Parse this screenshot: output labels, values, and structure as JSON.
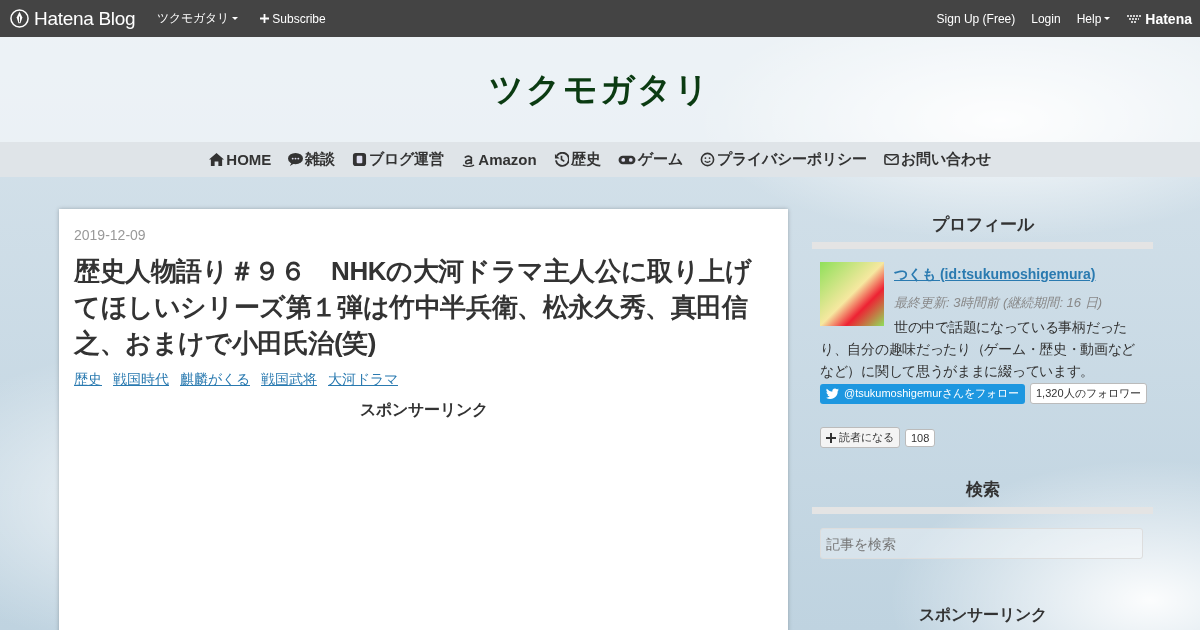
{
  "topbar": {
    "logo": "Hatena Blog",
    "blog_menu": "ツクモガタリ",
    "subscribe": "Subscribe",
    "links": [
      "Sign Up (Free)",
      "Login"
    ],
    "help": "Help",
    "brand": "Hatena"
  },
  "blog_title": "ツクモガタリ",
  "nav": [
    {
      "label": "HOME"
    },
    {
      "label": "雑談"
    },
    {
      "label": "ブログ運営"
    },
    {
      "label": "Amazon"
    },
    {
      "label": "歴史"
    },
    {
      "label": "ゲーム"
    },
    {
      "label": "プライバシーポリシー"
    },
    {
      "label": "お問い合わせ"
    }
  ],
  "article": {
    "date": "2019-12-09",
    "title": "歴史人物語り＃９６　NHKの大河ドラマ主人公に取り上げてほしいシリーズ第１弾は竹中半兵衛、松永久秀、真田信之、おまけで小田氏治(笑)",
    "categories": [
      "歴史",
      "戦国時代",
      "麒麟がくる",
      "戦国武将",
      "大河ドラマ"
    ],
    "sponsor": "スポンサーリンク"
  },
  "sidebar": {
    "profile": {
      "heading": "プロフィール",
      "name": "つくも (id:tsukumoshigemura)",
      "updated": "最終更新: 3時間前 (継続期間: 16 日)",
      "description": "世の中で話題になっている事柄だったり、自分の趣味だったり（ゲーム・歴史・動画などなど）に関して思うがままに綴っています。",
      "twitter_follow": "@tsukumoshigemurさんをフォロー",
      "twitter_count": "1,320人のフォロワー",
      "reader_button": "読者になる",
      "reader_count": "108"
    },
    "search": {
      "heading": "検索",
      "placeholder": "記事を検索"
    },
    "sponsor_heading": "スポンサーリンク"
  }
}
